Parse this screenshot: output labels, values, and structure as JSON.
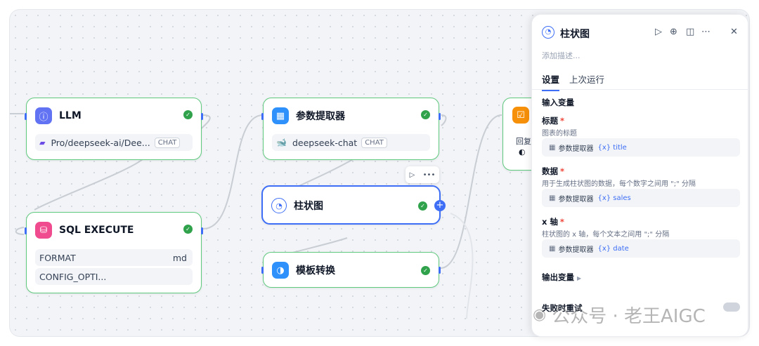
{
  "nodes": {
    "llm": {
      "title": "LLM",
      "model": "Pro/deepseek-ai/Dee...",
      "tag": "CHAT"
    },
    "param": {
      "title": "参数提取器",
      "model": "deepseek-chat",
      "tag": "CHAT"
    },
    "chart": {
      "title": "柱状图"
    },
    "sql": {
      "title": "SQL EXECUTE",
      "rows": [
        {
          "label": "FORMAT",
          "value": "md"
        },
        {
          "label": "CONFIG_OPTI...",
          "value": ""
        }
      ]
    },
    "template": {
      "title": "模板转换"
    },
    "answer": {
      "label": "回复"
    }
  },
  "panel": {
    "title": "柱状图",
    "description_placeholder": "添加描述...",
    "tabs": [
      "设置",
      "上次运行"
    ],
    "input_section": "输入变量",
    "fields": [
      {
        "label": "标题",
        "hint": "图表的标题",
        "source": "参数提取器",
        "var": "{x} title"
      },
      {
        "label": "数据",
        "hint": "用于生成柱状图的数据，每个数字之间用 \";\" 分隔",
        "source": "参数提取器",
        "var": "{x} sales"
      },
      {
        "label": "x 轴",
        "hint": "柱状图的 x 轴，每个文本之间用 \";\" 分隔",
        "source": "参数提取器",
        "var": "{x} date"
      }
    ],
    "output_section": "输出变量",
    "retry_section": "失败时重试"
  },
  "watermark": "公众号 · 老王AIGC",
  "colors": {
    "success": "#31a24c",
    "accent": "#3d6ef5",
    "node_border": "#5fc97e"
  }
}
